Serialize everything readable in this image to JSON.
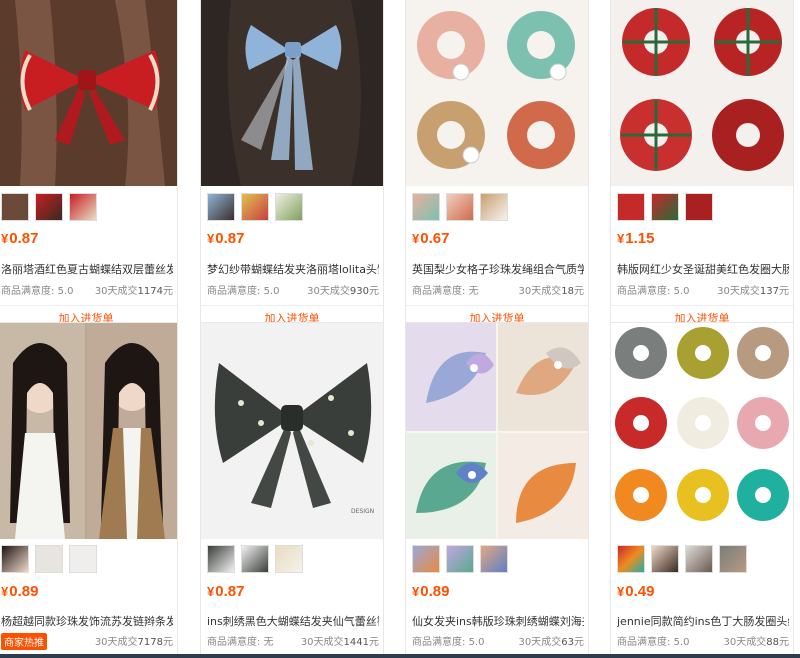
{
  "products": [
    {
      "price": "0.87",
      "title": "洛丽塔酒红色夏古蝴蝶结双层蕾丝发...",
      "satisfaction_label": "商品满意度:",
      "satisfaction": "5.0",
      "sold_prefix": "30天成交",
      "sold": "1174",
      "sold_suffix": "元",
      "button": "加入进货单"
    },
    {
      "price": "0.87",
      "title": "梦幻纱带蝴蝶结发夹洛丽塔lolita头饰...",
      "satisfaction_label": "商品满意度:",
      "satisfaction": "5.0",
      "sold_prefix": "30天成交",
      "sold": "930",
      "sold_suffix": "元",
      "button": "加入进货单"
    },
    {
      "price": "0.67",
      "title": "英国梨少女格子珍珠发绳组合气质学...",
      "satisfaction_label": "商品满意度:",
      "satisfaction": "无",
      "sold_prefix": "30天成交",
      "sold": "18",
      "sold_suffix": "元",
      "button": "加入进货单"
    },
    {
      "price": "1.15",
      "title": "韩版网红少女圣诞甜美红色发圈大肠...",
      "satisfaction_label": "商品满意度:",
      "satisfaction": "5.0",
      "sold_prefix": "30天成交",
      "sold": "137",
      "sold_suffix": "元",
      "button": "加入进货单"
    },
    {
      "price": "0.89",
      "title": "杨超越同款珍珠发饰流苏发链辫条发夹...",
      "hot_badge": "商家热推",
      "sold_prefix": "30天成交",
      "sold": "7178",
      "sold_suffix": "元"
    },
    {
      "price": "0.87",
      "title": "ins刺绣黑色大蝴蝶结发夹仙气蕾丝簪...",
      "satisfaction_label": "商品满意度:",
      "satisfaction": "无",
      "sold_prefix": "30天成交",
      "sold": "1441",
      "sold_suffix": "元"
    },
    {
      "price": "0.89",
      "title": "仙女发夹ins韩版珍珠刺绣蝴蝶刘海夹...",
      "satisfaction_label": "商品满意度:",
      "satisfaction": "5.0",
      "sold_prefix": "30天成交",
      "sold": "63",
      "sold_suffix": "元"
    },
    {
      "price": "0.49",
      "title": "jennie同款简约ins色丁大肠发圈头绳...",
      "satisfaction_label": "商品满意度:",
      "satisfaction": "5.0",
      "sold_prefix": "30天成交",
      "sold": "88",
      "sold_suffix": "元"
    }
  ],
  "currency": "¥",
  "colors": {
    "accent": "#ff5000",
    "border": "#e8e8e8"
  }
}
